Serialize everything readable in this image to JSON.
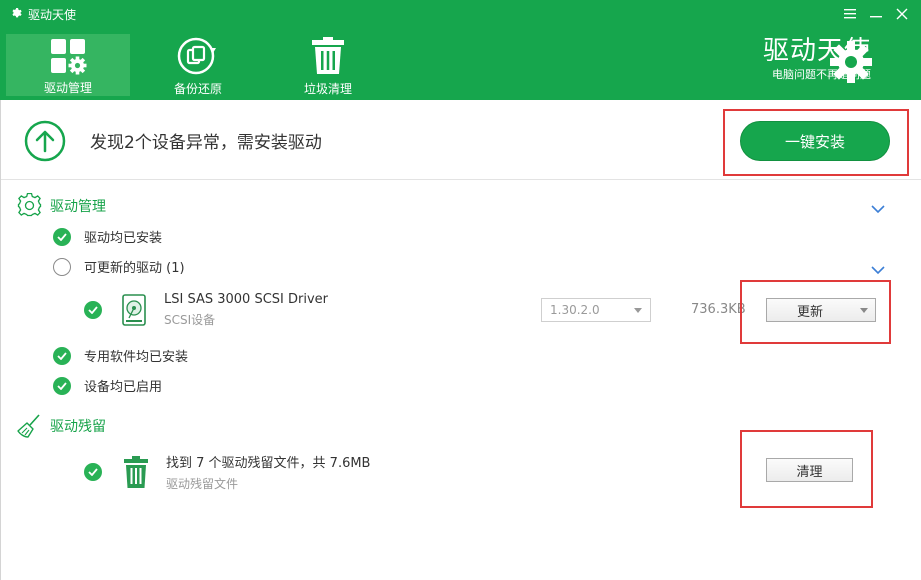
{
  "app": {
    "title": "驱动天使",
    "brand_name": "驱动天使",
    "brand_slogan": "电脑问题不再是问题",
    "colors": {
      "primary": "#16a64d",
      "active_tab": "#35b561",
      "accent_text": "#17a34a",
      "check": "#29b256",
      "highlight_box": "#e03a3a"
    }
  },
  "window_controls": {
    "icons": [
      "menu-icon",
      "minimize-icon",
      "close-icon"
    ]
  },
  "nav": {
    "tabs": [
      {
        "label": "驱动管理",
        "icon": "driver-manage-icon",
        "active": true
      },
      {
        "label": "备份还原",
        "icon": "backup-restore-icon",
        "active": false
      },
      {
        "label": "垃圾清理",
        "icon": "trash-icon",
        "active": false
      }
    ]
  },
  "alert": {
    "icon": "up-arrow-circle-icon",
    "text": "发现2个设备异常，需安装驱动",
    "install_button": "一键安装"
  },
  "driver_section": {
    "title": "驱动管理",
    "icon": "gear-outline-icon",
    "rows": {
      "all_installed": "驱动均已安装",
      "updatable": "可更新的驱动 (1)"
    },
    "driver_item": {
      "name": "LSI SAS 3000 SCSI Driver",
      "category": "SCSI设备",
      "icon": "hard-drive-icon",
      "version": "1.30.2.0",
      "size": "736.3KB",
      "action": "更新"
    },
    "software_installed": "专用软件均已安装",
    "devices_enabled": "设备均已启用"
  },
  "residue_section": {
    "title": "驱动残留",
    "icon": "broom-icon",
    "item": {
      "text": "找到 7 个驱动残留文件，共 7.6MB",
      "sub": "驱动残留文件",
      "icon": "trash-can-icon",
      "action": "清理"
    }
  }
}
